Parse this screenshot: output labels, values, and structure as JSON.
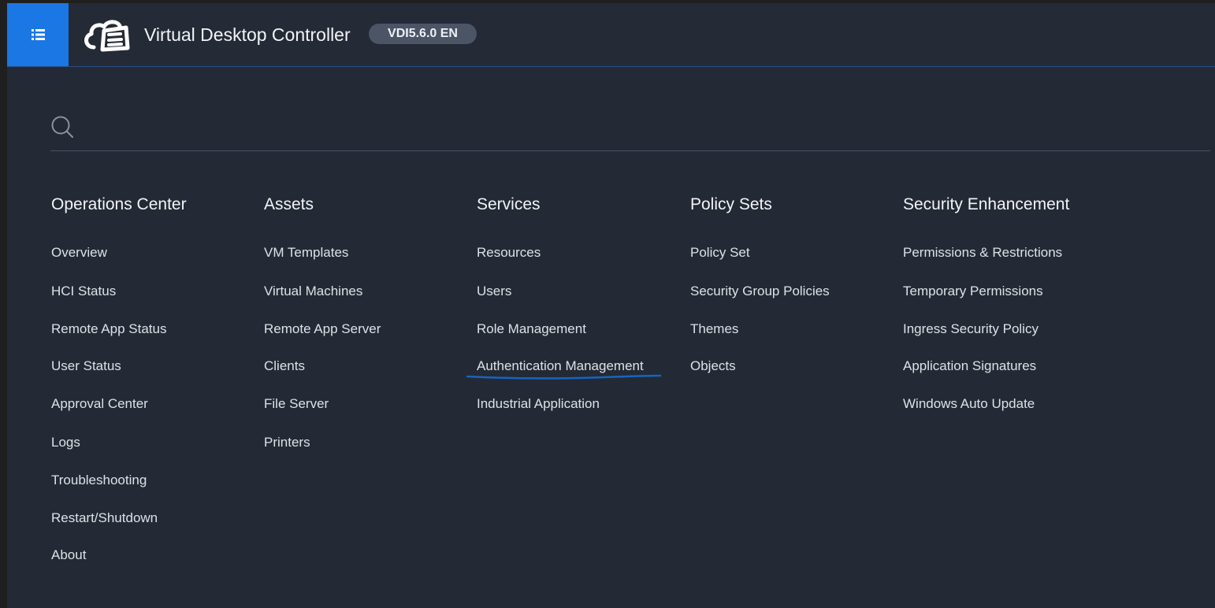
{
  "header": {
    "app_title": "Virtual Desktop Controller",
    "version_badge": "VDI5.6.0 EN",
    "menu_icon": "list-menu-icon",
    "logo_icon": "cloud-desktop-logo"
  },
  "search": {
    "placeholder": "",
    "value": "",
    "icon": "search-icon"
  },
  "columns": [
    {
      "title": "Operations Center",
      "items": [
        "Overview",
        "HCI Status",
        "Remote App Status",
        "User Status",
        "Approval Center",
        "Logs",
        "Troubleshooting",
        "Restart/Shutdown",
        "About"
      ]
    },
    {
      "title": "Assets",
      "items": [
        "VM Templates",
        "Virtual Machines",
        "Remote App Server",
        "Clients",
        "File Server",
        "Printers"
      ]
    },
    {
      "title": "Services",
      "items": [
        "Resources",
        "Users",
        "Role Management",
        "Authentication Management",
        "Industrial Application"
      ]
    },
    {
      "title": "Policy Sets",
      "items": [
        "Policy Set",
        "Security Group Policies",
        "Themes",
        "Objects"
      ]
    },
    {
      "title": "Security Enhancement",
      "items": [
        "Permissions & Restrictions",
        "Temporary Permissions",
        "Ingress Security Policy",
        "Application Signatures",
        "Windows Auto Update"
      ]
    }
  ],
  "highlighted_item": "Authentication Management",
  "colors": {
    "background": "#232a35",
    "accent": "#1b77e3",
    "badge": "#4b5566",
    "annotation": "#1565c0"
  }
}
